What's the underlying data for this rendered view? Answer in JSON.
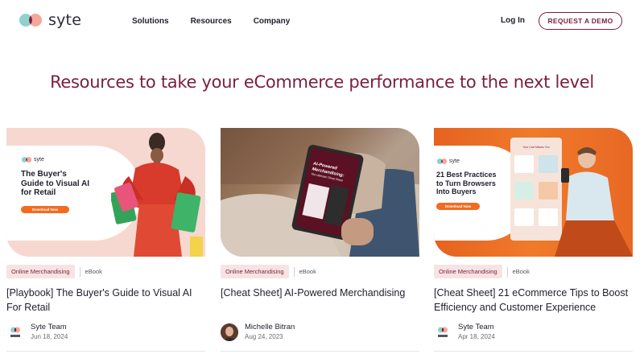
{
  "brand": {
    "name": "syte"
  },
  "nav": {
    "items": [
      "Solutions",
      "Resources",
      "Company"
    ]
  },
  "header": {
    "login_label": "Log In",
    "demo_label": "REQUEST A DEMO"
  },
  "hero": {
    "title": "Resources to take your eCommerce performance to the next level"
  },
  "cards": [
    {
      "image_promo": {
        "brand": "syte",
        "title_lines": [
          "The Buyer's",
          "Guide to Visual AI",
          "for Retail"
        ],
        "button": "Download Now"
      },
      "tag": "Online Merchandising",
      "type": "eBook",
      "title": "[Playbook] The Buyer's Guide to Visual AI For Retail",
      "author": "Syte Team",
      "date": "Jun 18, 2024",
      "avatar_icon": "syte-logo-icon"
    },
    {
      "image_promo": {
        "title_lines": [
          "AI-Powered",
          "Merchandising:",
          "The Ultimate Cheat Sheet"
        ]
      },
      "tag": "Online Merchandising",
      "type": "eBook",
      "title": "[Cheat Sheet] AI-Powered Merchandising",
      "author": "Michelle Bitran",
      "date": "Aug 24, 2023",
      "avatar_icon": "person-photo"
    },
    {
      "image_promo": {
        "brand": "syte",
        "title_lines": [
          "21 Best Practices",
          "to Turn Browsers",
          "Into Buyers"
        ],
        "button": "Download Now",
        "phone_header": "Your Cart Misses You"
      },
      "tag": "Online Merchandising",
      "type": "eBook",
      "title": "[Cheat Sheet] 21 eCommerce Tips to Boost Efficiency and Customer Experience",
      "author": "Syte Team",
      "date": "Apr 18, 2024",
      "avatar_icon": "syte-logo-icon"
    }
  ],
  "colors": {
    "brand": "#7a1f3a",
    "accent": "#f26b21",
    "tag_bg": "#f7e3e3"
  }
}
